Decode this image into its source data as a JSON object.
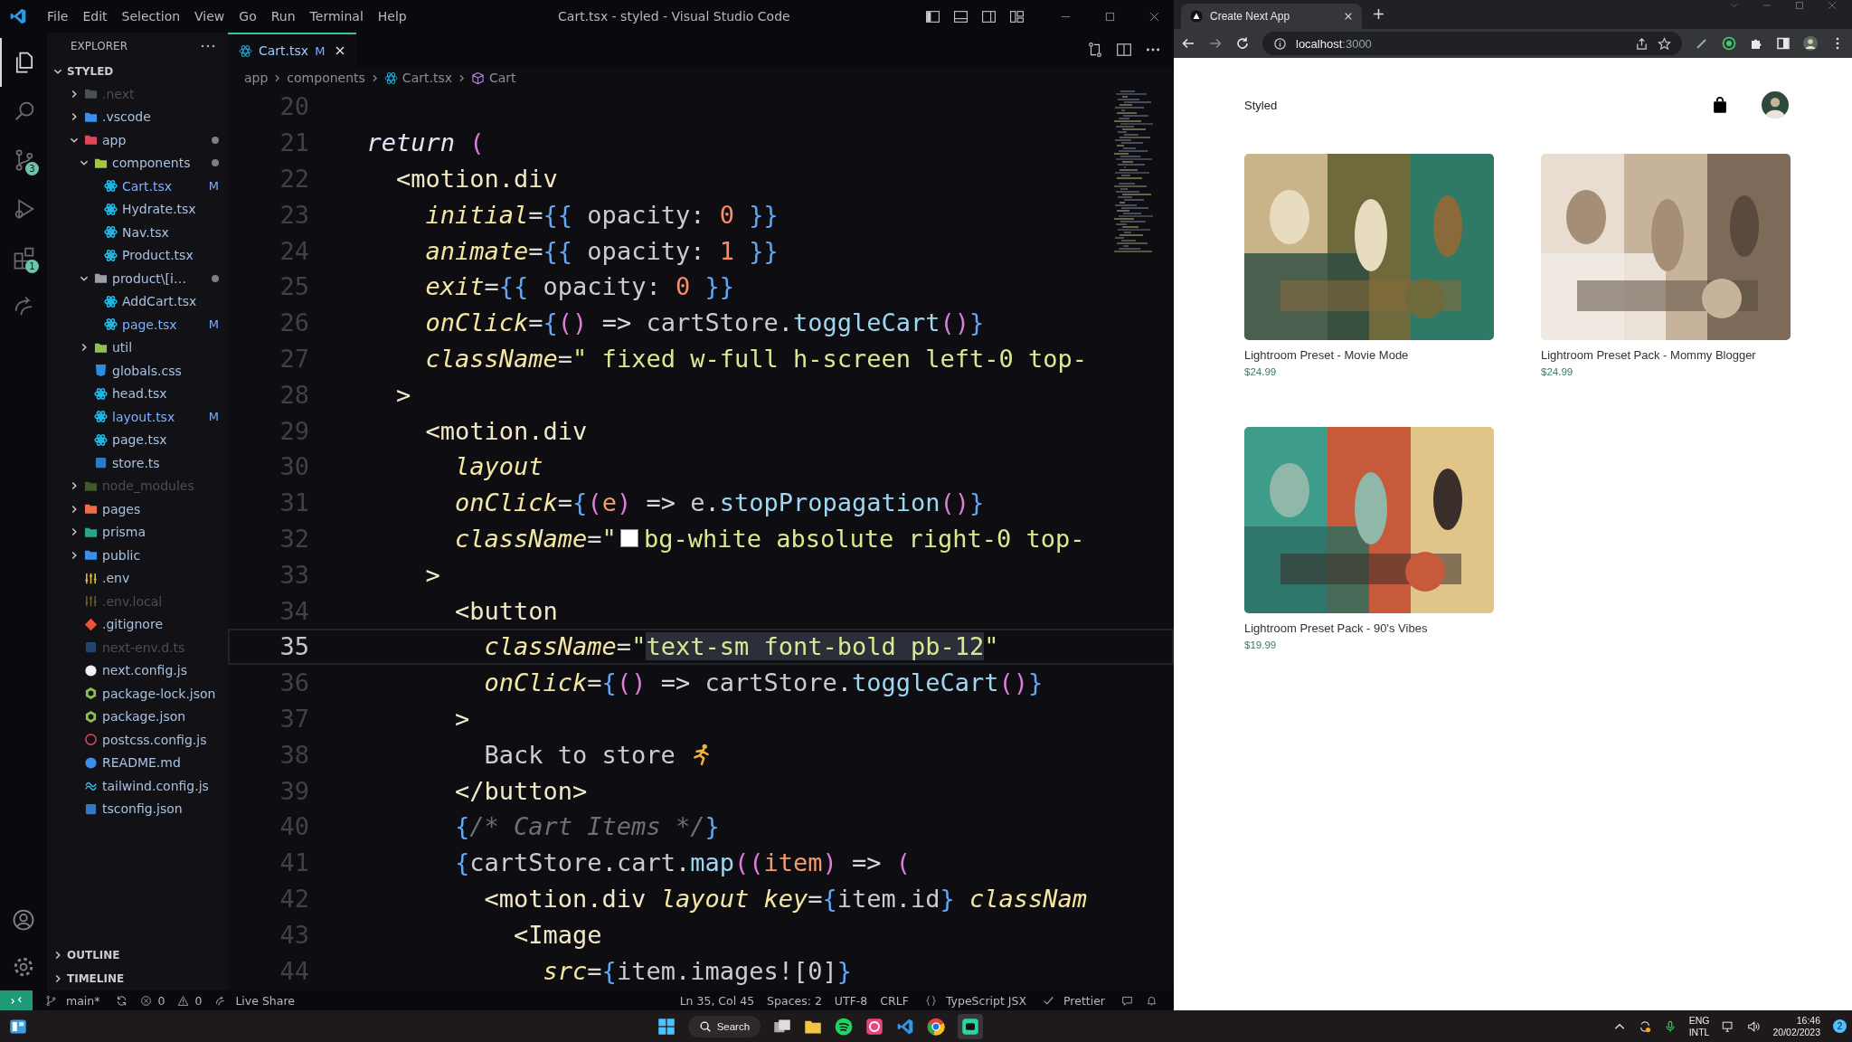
{
  "vscode": {
    "title": "Cart.tsx - styled - Visual Studio Code",
    "menu": [
      "File",
      "Edit",
      "Selection",
      "View",
      "Go",
      "Run",
      "Terminal",
      "Help"
    ],
    "activity": [
      {
        "kind": "explorer",
        "selected": true
      },
      {
        "kind": "search",
        "selected": false
      },
      {
        "kind": "source-control",
        "selected": false,
        "badge": "3"
      },
      {
        "kind": "run",
        "selected": false
      },
      {
        "kind": "extensions",
        "selected": false,
        "badge": "1"
      },
      {
        "kind": "live-share",
        "selected": false
      }
    ],
    "explorer": {
      "title": "EXPLORER",
      "workspace": "STYLED",
      "items": [
        {
          "name": ".next",
          "kind": "folder",
          "color": "#4a4e55",
          "expanded": false,
          "ignored": true,
          "dot": false
        },
        {
          "name": ".vscode",
          "kind": "folder",
          "color": "#3b8eea",
          "expanded": false,
          "ignored": false,
          "dot": false
        },
        {
          "name": "app",
          "kind": "folder",
          "color": "#e0475b",
          "expanded": true,
          "ignored": false,
          "dot": true,
          "children": [
            {
              "name": "components",
              "kind": "folder",
              "color": "#a5c63b",
              "expanded": true,
              "ignored": false,
              "dot": true,
              "children": [
                {
                  "name": "Cart.tsx",
                  "kind": "react",
                  "color": "#22b8e5",
                  "ignored": false,
                  "dot": false,
                  "badge": "M"
                },
                {
                  "name": "Hydrate.tsx",
                  "kind": "react",
                  "color": "#22b8e5",
                  "ignored": false,
                  "dot": false
                },
                {
                  "name": "Nav.tsx",
                  "kind": "react",
                  "color": "#22b8e5",
                  "ignored": false,
                  "dot": false
                },
                {
                  "name": "Product.tsx",
                  "kind": "react",
                  "color": "#22b8e5",
                  "ignored": false,
                  "dot": false
                }
              ]
            },
            {
              "name": "product\\[i…",
              "kind": "folder",
              "color": "#9aa0a6",
              "expanded": true,
              "ignored": false,
              "dot": true,
              "children": [
                {
                  "name": "AddCart.tsx",
                  "kind": "react",
                  "color": "#22b8e5",
                  "ignored": false,
                  "dot": false
                },
                {
                  "name": "page.tsx",
                  "kind": "react",
                  "color": "#22b8e5",
                  "ignored": false,
                  "dot": false,
                  "badge": "M"
                }
              ]
            },
            {
              "name": "util",
              "kind": "folder",
              "color": "#8bc34a",
              "expanded": false,
              "ignored": false,
              "dot": false
            },
            {
              "name": "globals.css",
              "kind": "css",
              "color": "#2f8ddb",
              "ignored": false,
              "dot": false
            },
            {
              "name": "head.tsx",
              "kind": "react",
              "color": "#22b8e5",
              "ignored": false,
              "dot": false
            },
            {
              "name": "layout.tsx",
              "kind": "react",
              "color": "#22b8e5",
              "ignored": false,
              "dot": false,
              "badge": "M"
            },
            {
              "name": "page.tsx",
              "kind": "react",
              "color": "#22b8e5",
              "ignored": false,
              "dot": false
            },
            {
              "name": "store.ts",
              "kind": "ts",
              "color": "#3178c6",
              "ignored": false,
              "dot": false
            }
          ]
        },
        {
          "name": "node_modules",
          "kind": "folder",
          "color": "#3f5a2a",
          "expanded": false,
          "ignored": true,
          "dot": false
        },
        {
          "name": "pages",
          "kind": "folder",
          "color": "#ef6c4a",
          "expanded": false,
          "ignored": false,
          "dot": false
        },
        {
          "name": "prisma",
          "kind": "folder",
          "color": "#27a78b",
          "expanded": false,
          "ignored": false,
          "dot": false
        },
        {
          "name": "public",
          "kind": "folder",
          "color": "#3b8eea",
          "expanded": false,
          "ignored": false,
          "dot": false
        },
        {
          "name": ".env",
          "kind": "env",
          "color": "#e6c24a",
          "ignored": false,
          "dot": false
        },
        {
          "name": ".env.local",
          "kind": "env",
          "color": "#6e5e2a",
          "ignored": true,
          "dot": false
        },
        {
          "name": ".gitignore",
          "kind": "git",
          "color": "#e8553a",
          "ignored": false,
          "dot": false
        },
        {
          "name": "next-env.d.ts",
          "kind": "ts",
          "color": "#23446e",
          "ignored": true,
          "dot": false
        },
        {
          "name": "next.config.js",
          "kind": "next",
          "color": "#f0f0f0",
          "ignored": false,
          "dot": false
        },
        {
          "name": "package-lock.json",
          "kind": "node",
          "color": "#8bc34a",
          "ignored": false,
          "dot": false
        },
        {
          "name": "package.json",
          "kind": "node",
          "color": "#8bc34a",
          "ignored": false,
          "dot": false
        },
        {
          "name": "postcss.config.js",
          "kind": "postcss",
          "color": "#e0475b",
          "ignored": false,
          "dot": false
        },
        {
          "name": "README.md",
          "kind": "info",
          "color": "#3b8eea",
          "ignored": false,
          "dot": false
        },
        {
          "name": "tailwind.config.js",
          "kind": "tailwind",
          "color": "#38bdf8",
          "ignored": false,
          "dot": false
        },
        {
          "name": "tsconfig.json",
          "kind": "ts",
          "color": "#3178c6",
          "ignored": false,
          "dot": false
        }
      ]
    },
    "panels": [
      "OUTLINE",
      "TIMELINE"
    ],
    "tab": {
      "name": "Cart.tsx",
      "badge": "M"
    },
    "breadcrumbs": [
      {
        "text": "app",
        "kind": "folder"
      },
      {
        "text": "components",
        "kind": "folder"
      },
      {
        "text": "Cart.tsx",
        "kind": "react"
      },
      {
        "text": "Cart",
        "kind": "component"
      }
    ],
    "code": [
      {
        "number": "20",
        "current": false
      },
      {
        "number": "21",
        "current": false,
        "tokens": [
          {
            "text": "  return",
            "kind": "keyword"
          },
          {
            "text": " (",
            "kind": "paren"
          }
        ]
      },
      {
        "number": "22",
        "current": false,
        "tokens": [
          {
            "text": "    <motion.div",
            "kind": "tag"
          }
        ]
      },
      {
        "number": "23",
        "current": false,
        "tokens": [
          {
            "text": "      initial",
            "kind": "attr"
          },
          {
            "text": "=",
            "kind": "punct"
          },
          {
            "text": "{{",
            "kind": "brace"
          },
          {
            "text": " opacity: ",
            "kind": "prop"
          },
          {
            "text": "0",
            "kind": "number"
          },
          {
            "text": " }}",
            "kind": "brace"
          }
        ]
      },
      {
        "number": "24",
        "current": false,
        "tokens": [
          {
            "text": "      animate",
            "kind": "attr"
          },
          {
            "text": "=",
            "kind": "punct"
          },
          {
            "text": "{{",
            "kind": "brace"
          },
          {
            "text": " opacity: ",
            "kind": "prop"
          },
          {
            "text": "1",
            "kind": "number"
          },
          {
            "text": " }}",
            "kind": "brace"
          }
        ]
      },
      {
        "number": "25",
        "current": false,
        "tokens": [
          {
            "text": "      exit",
            "kind": "attr"
          },
          {
            "text": "=",
            "kind": "punct"
          },
          {
            "text": "{{",
            "kind": "brace"
          },
          {
            "text": " opacity: ",
            "kind": "prop"
          },
          {
            "text": "0",
            "kind": "number"
          },
          {
            "text": " }}",
            "kind": "brace"
          }
        ]
      },
      {
        "number": "26",
        "current": false,
        "tokens": [
          {
            "text": "      onClick",
            "kind": "attr"
          },
          {
            "text": "=",
            "kind": "punct"
          },
          {
            "text": "{",
            "kind": "brace"
          },
          {
            "text": "()",
            "kind": "paren"
          },
          {
            "text": " => ",
            "kind": "punct"
          },
          {
            "text": "cartStore",
            "kind": "prop"
          },
          {
            "text": ".",
            "kind": "punct"
          },
          {
            "text": "toggleCart",
            "kind": "func"
          },
          {
            "text": "()",
            "kind": "paren"
          },
          {
            "text": "}",
            "kind": "brace"
          }
        ]
      },
      {
        "number": "27",
        "current": false,
        "tokens": [
          {
            "text": "      className",
            "kind": "attr"
          },
          {
            "text": "=",
            "kind": "punct"
          },
          {
            "text": "\" fixed w-full h-screen left-0 top-",
            "kind": "string"
          }
        ]
      },
      {
        "number": "28",
        "current": false,
        "tokens": [
          {
            "text": "    >",
            "kind": "tag"
          }
        ]
      },
      {
        "number": "29",
        "current": false,
        "tokens": [
          {
            "text": "      <motion.div",
            "kind": "tag"
          }
        ]
      },
      {
        "number": "30",
        "current": false,
        "tokens": [
          {
            "text": "        layout",
            "kind": "attr"
          }
        ]
      },
      {
        "number": "31",
        "current": false,
        "tokens": [
          {
            "text": "        onClick",
            "kind": "attr"
          },
          {
            "text": "=",
            "kind": "punct"
          },
          {
            "text": "{",
            "kind": "brace"
          },
          {
            "text": "(",
            "kind": "paren"
          },
          {
            "text": "e",
            "kind": "param"
          },
          {
            "text": ")",
            "kind": "paren"
          },
          {
            "text": " => ",
            "kind": "punct"
          },
          {
            "text": "e",
            "kind": "prop"
          },
          {
            "text": ".",
            "kind": "punct"
          },
          {
            "text": "stopPropagation",
            "kind": "func"
          },
          {
            "text": "()",
            "kind": "paren"
          },
          {
            "text": "}",
            "kind": "brace"
          }
        ]
      },
      {
        "number": "32",
        "current": false,
        "tokens": [
          {
            "text": "        className",
            "kind": "attr"
          },
          {
            "text": "=",
            "kind": "punct"
          },
          {
            "text": "\"",
            "kind": "string"
          },
          {
            "kind": "swatch",
            "color": "#ffffff"
          },
          {
            "text": "bg-white absolute right-0 top-",
            "kind": "string"
          }
        ]
      },
      {
        "number": "33",
        "current": false,
        "tokens": [
          {
            "text": "      >",
            "kind": "tag"
          }
        ]
      },
      {
        "number": "34",
        "current": false,
        "tokens": [
          {
            "text": "        <button",
            "kind": "tag"
          }
        ]
      },
      {
        "number": "35",
        "current": true,
        "tokens": [
          {
            "text": "          className",
            "kind": "attr"
          },
          {
            "text": "=",
            "kind": "punct"
          },
          {
            "text": "\"",
            "kind": "string"
          },
          {
            "text": "text-sm font-bold pb-12",
            "kind": "selected-string"
          },
          {
            "text": "\"",
            "kind": "string"
          }
        ]
      },
      {
        "number": "36",
        "current": false,
        "tokens": [
          {
            "text": "          onClick",
            "kind": "attr"
          },
          {
            "text": "=",
            "kind": "punct"
          },
          {
            "text": "{",
            "kind": "brace"
          },
          {
            "text": "()",
            "kind": "paren"
          },
          {
            "text": " => ",
            "kind": "punct"
          },
          {
            "text": "cartStore",
            "kind": "prop"
          },
          {
            "text": ".",
            "kind": "punct"
          },
          {
            "text": "toggleCart",
            "kind": "func"
          },
          {
            "text": "()",
            "kind": "paren"
          },
          {
            "text": "}",
            "kind": "brace"
          }
        ]
      },
      {
        "number": "37",
        "current": false,
        "tokens": [
          {
            "text": "        >",
            "kind": "tag"
          }
        ]
      },
      {
        "number": "38",
        "current": false,
        "tokens": [
          {
            "text": "          Back to store",
            "kind": "text"
          },
          {
            "kind": "runner"
          }
        ]
      },
      {
        "number": "39",
        "current": false,
        "tokens": [
          {
            "text": "        </button>",
            "kind": "tag"
          }
        ]
      },
      {
        "number": "40",
        "current": false,
        "tokens": [
          {
            "text": "        {",
            "kind": "brace"
          },
          {
            "text": "/* Cart Items */",
            "kind": "comment"
          },
          {
            "text": "}",
            "kind": "brace"
          }
        ]
      },
      {
        "number": "41",
        "current": false,
        "tokens": [
          {
            "text": "        {",
            "kind": "brace"
          },
          {
            "text": "cartStore",
            "kind": "prop"
          },
          {
            "text": ".",
            "kind": "punct"
          },
          {
            "text": "cart",
            "kind": "prop"
          },
          {
            "text": ".",
            "kind": "punct"
          },
          {
            "text": "map",
            "kind": "func"
          },
          {
            "text": "((",
            "kind": "paren"
          },
          {
            "text": "item",
            "kind": "param"
          },
          {
            "text": ")",
            "kind": "paren"
          },
          {
            "text": " => ",
            "kind": "punct"
          },
          {
            "text": "(",
            "kind": "paren"
          }
        ]
      },
      {
        "number": "42",
        "current": false,
        "tokens": [
          {
            "text": "          <motion.div",
            "kind": "tag"
          },
          {
            "text": " layout",
            "kind": "attr"
          },
          {
            "text": " key",
            "kind": "attr"
          },
          {
            "text": "=",
            "kind": "punct"
          },
          {
            "text": "{",
            "kind": "brace"
          },
          {
            "text": "item.id",
            "kind": "prop"
          },
          {
            "text": "}",
            "kind": "brace"
          },
          {
            "text": " classNam",
            "kind": "attr"
          }
        ]
      },
      {
        "number": "43",
        "current": false,
        "tokens": [
          {
            "text": "            <Image",
            "kind": "tag"
          }
        ]
      },
      {
        "number": "44",
        "current": false,
        "tokens": [
          {
            "text": "              src",
            "kind": "attr"
          },
          {
            "text": "=",
            "kind": "punct"
          },
          {
            "text": "{",
            "kind": "brace"
          },
          {
            "text": "item.images![0]",
            "kind": "prop"
          },
          {
            "text": "}",
            "kind": "brace"
          }
        ]
      }
    ],
    "status": {
      "branch": "main*",
      "errors": "0",
      "warnings": "0",
      "live_share": "Live Share",
      "position": "Ln 35, Col 45",
      "spaces": "Spaces: 2",
      "encoding": "UTF-8",
      "eol": "CRLF",
      "language": "TypeScript JSX",
      "formatter": "Prettier"
    }
  },
  "browser": {
    "tab": "Create Next App",
    "url_host": "localhost",
    "url_port": ":3000",
    "page": {
      "brand": "Styled",
      "products": [
        {
          "title": "Lightroom Preset - Movie Mode",
          "price": "$24.99"
        },
        {
          "title": "Lightroom Preset Pack - Mommy Blogger",
          "price": "$24.99"
        },
        {
          "title": "Lightroom Preset Pack - 90's Vibes",
          "price": "$19.99"
        }
      ]
    }
  },
  "taskbar": {
    "search": "Search",
    "apps": [
      {
        "kind": "files"
      },
      {
        "kind": "spotify"
      },
      {
        "kind": "photos"
      },
      {
        "kind": "vscode"
      },
      {
        "kind": "chrome"
      },
      {
        "kind": "chat"
      }
    ],
    "language": "ENG",
    "layout": "INTL",
    "time": "16:46",
    "date": "20/02/2023",
    "notifications": "2"
  }
}
